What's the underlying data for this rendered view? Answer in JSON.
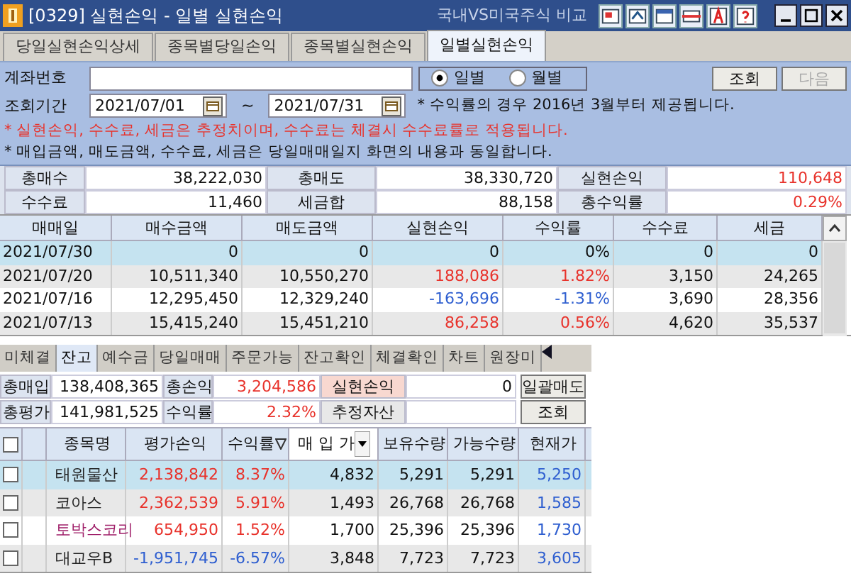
{
  "window": {
    "title": "[0329] 실현손익 - 일별 실현손익",
    "compare_link": "국내VS미국주식 비교"
  },
  "tabs": [
    {
      "label": "당일실현손익상세",
      "selected": false
    },
    {
      "label": "종목별당일손익",
      "selected": false
    },
    {
      "label": "종목별실현손익",
      "selected": false
    },
    {
      "label": "일별실현손익",
      "selected": true
    }
  ],
  "form": {
    "account_label": "계좌번호",
    "period_options": [
      {
        "label": "일별",
        "selected": true
      },
      {
        "label": "월별",
        "selected": false
      }
    ],
    "buttons": [
      {
        "label": "조회",
        "disabled": false
      },
      {
        "label": "다음",
        "disabled": true
      }
    ],
    "period_label": "조회기간",
    "date_from": "2021/07/01",
    "range_separator": "~",
    "date_to": "2021/07/31",
    "side_note": "* 수익률의 경우 2016년 3월부터 제공됩니다.",
    "notes": [
      {
        "text": "* 실현손익, 수수료, 세금은 추정치이며, 수수료는 체결시 수수료률로 적용됩니다.",
        "kind": "warning"
      },
      {
        "text": "* 매입금액, 매도금액, 수수료, 세금은 당일매매일지 화면의 내용과 동일합니다.",
        "kind": "info"
      }
    ]
  },
  "summary": [
    [
      {
        "label": "총매수",
        "value": "38,222,030",
        "color": "#111111"
      },
      {
        "label": "총매도",
        "value": "38,330,720",
        "color": "#111111"
      },
      {
        "label": "실현손익",
        "value": "110,648",
        "color": "#e8322b"
      }
    ],
    [
      {
        "label": "수수료",
        "value": "11,460",
        "color": "#111111"
      },
      {
        "label": "세금합",
        "value": "88,158",
        "color": "#111111"
      },
      {
        "label": "총수익률",
        "value": "0.29%",
        "color": "#e8322b"
      }
    ]
  ],
  "table": {
    "columns": [
      "매매일",
      "매수금액",
      "매도금액",
      "실현손익",
      "수익률",
      "수수료",
      "세금"
    ],
    "rows": [
      {
        "selected": true,
        "cells": [
          {
            "text": "2021/07/30",
            "color": "#111111"
          },
          {
            "text": "0",
            "color": "#111111"
          },
          {
            "text": "0",
            "color": "#111111"
          },
          {
            "text": "0",
            "color": "#111111"
          },
          {
            "text": "0%",
            "color": "#111111"
          },
          {
            "text": "0",
            "color": "#111111"
          },
          {
            "text": "0",
            "color": "#111111"
          }
        ]
      },
      {
        "selected": false,
        "cells": [
          {
            "text": "2021/07/20",
            "color": "#111111"
          },
          {
            "text": "10,511,340",
            "color": "#111111"
          },
          {
            "text": "10,550,270",
            "color": "#111111"
          },
          {
            "text": "188,086",
            "color": "#e8322b"
          },
          {
            "text": "1.82%",
            "color": "#e8322b"
          },
          {
            "text": "3,150",
            "color": "#111111"
          },
          {
            "text": "24,265",
            "color": "#111111"
          }
        ]
      },
      {
        "selected": false,
        "cells": [
          {
            "text": "2021/07/16",
            "color": "#111111"
          },
          {
            "text": "12,295,450",
            "color": "#111111"
          },
          {
            "text": "12,329,240",
            "color": "#111111"
          },
          {
            "text": "-163,696",
            "color": "#2f5fd0"
          },
          {
            "text": "-1.31%",
            "color": "#2f5fd0"
          },
          {
            "text": "3,690",
            "color": "#111111"
          },
          {
            "text": "28,356",
            "color": "#111111"
          }
        ]
      },
      {
        "selected": false,
        "cells": [
          {
            "text": "2021/07/13",
            "color": "#111111"
          },
          {
            "text": "15,415,240",
            "color": "#111111"
          },
          {
            "text": "15,451,210",
            "color": "#111111"
          },
          {
            "text": "86,258",
            "color": "#e8322b"
          },
          {
            "text": "0.56%",
            "color": "#e8322b"
          },
          {
            "text": "4,620",
            "color": "#111111"
          },
          {
            "text": "35,537",
            "color": "#111111"
          }
        ]
      }
    ]
  },
  "bottom_tabs": [
    {
      "label": "미체결",
      "selected": false
    },
    {
      "label": "잔고",
      "selected": true
    },
    {
      "label": "예수금",
      "selected": false
    },
    {
      "label": "당일매매",
      "selected": false
    },
    {
      "label": "주문가능",
      "selected": false
    },
    {
      "label": "잔고확인",
      "selected": false
    },
    {
      "label": "체결확인",
      "selected": false
    },
    {
      "label": "차트",
      "selected": false
    },
    {
      "label": "원장미",
      "selected": false
    }
  ],
  "balance": {
    "rows": [
      [
        {
          "label": "총매입",
          "value": "138,408,365",
          "color": "#111111"
        },
        {
          "label": "총손익",
          "value": "3,204,586",
          "color": "#e8322b"
        },
        {
          "label": "실현손익",
          "value": "0",
          "color": "#111111",
          "highlight": true
        }
      ],
      [
        {
          "label": "총평가",
          "value": "141,981,525",
          "color": "#111111"
        },
        {
          "label": "수익률",
          "value": "2.32%",
          "color": "#e8322b"
        },
        {
          "label": "추정자산",
          "highlight": false
        }
      ]
    ],
    "buttons": [
      "일괄매도",
      "조회"
    ]
  },
  "holdings": {
    "all_checked": false,
    "columns": [
      "종목명",
      "평가손익",
      "수익률",
      "매 입 가",
      "보유수량",
      "가능수량",
      "현재가"
    ],
    "rows": [
      {
        "selected": true,
        "checked": false,
        "name": {
          "text": "태원물산",
          "color": "#222222"
        },
        "pnl": {
          "text": "2,138,842",
          "color": "#e8322b"
        },
        "rate": {
          "text": "8.37%",
          "color": "#e8322b"
        },
        "buy_price": "4,832",
        "held": "5,291",
        "available": "5,291",
        "price": {
          "text": "5,250",
          "color": "#2f5fd0"
        }
      },
      {
        "selected": false,
        "checked": false,
        "name": {
          "text": "코아스",
          "color": "#222222"
        },
        "pnl": {
          "text": "2,362,539",
          "color": "#e8322b"
        },
        "rate": {
          "text": "5.91%",
          "color": "#e8322b"
        },
        "buy_price": "1,493",
        "held": "26,768",
        "available": "26,768",
        "price": {
          "text": "1,585",
          "color": "#2f5fd0"
        }
      },
      {
        "selected": false,
        "checked": false,
        "name": {
          "text": "토박스코리",
          "color": "#a0206a"
        },
        "pnl": {
          "text": "654,950",
          "color": "#e8322b"
        },
        "rate": {
          "text": "1.52%",
          "color": "#e8322b"
        },
        "buy_price": "1,700",
        "held": "25,396",
        "available": "25,396",
        "price": {
          "text": "1,730",
          "color": "#2f5fd0"
        }
      },
      {
        "selected": false,
        "checked": false,
        "name": {
          "text": "대교우B",
          "color": "#222222"
        },
        "pnl": {
          "text": "-1,951,745",
          "color": "#2f5fd0"
        },
        "rate": {
          "text": "-6.57%",
          "color": "#2f5fd0"
        },
        "buy_price": "3,848",
        "held": "7,723",
        "available": "7,723",
        "price": {
          "text": "3,605",
          "color": "#2f5fd0"
        }
      }
    ]
  }
}
